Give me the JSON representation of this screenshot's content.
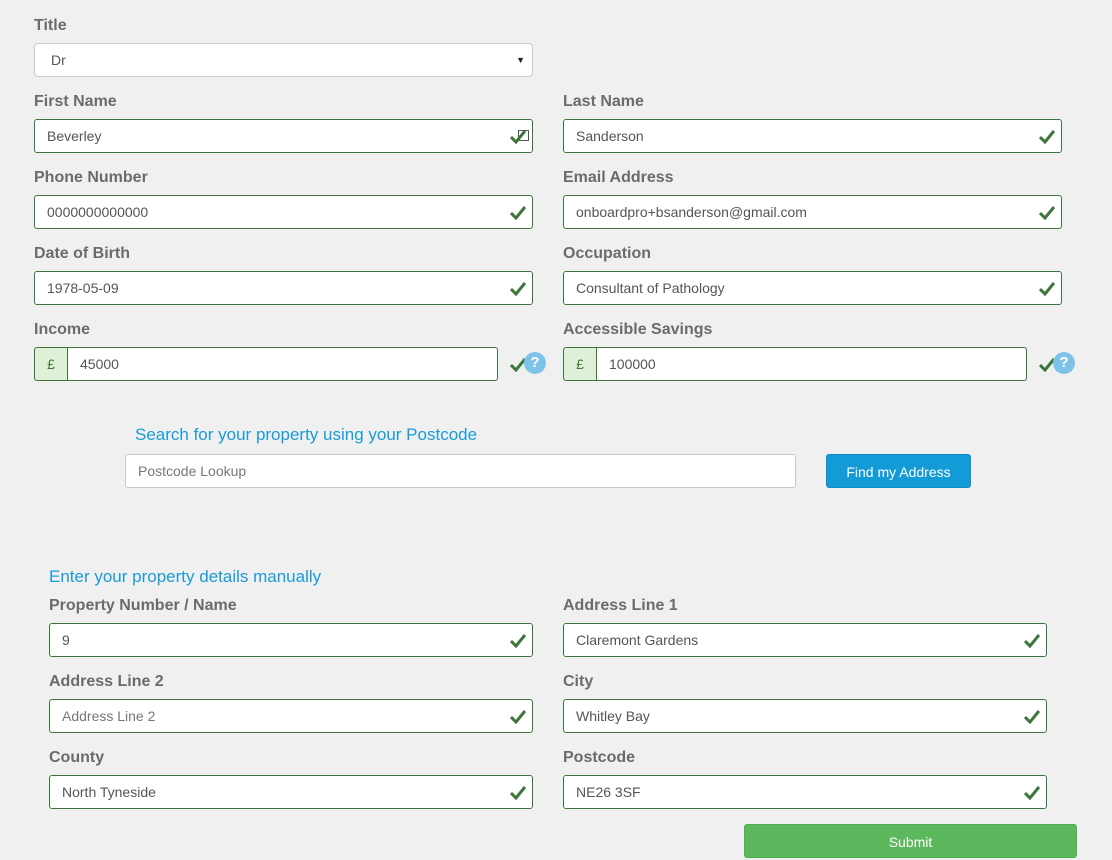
{
  "title": {
    "label": "Title",
    "value": "Dr"
  },
  "first_name": {
    "label": "First Name",
    "value": "Beverley"
  },
  "last_name": {
    "label": "Last Name",
    "value": "Sanderson"
  },
  "phone": {
    "label": "Phone Number",
    "value": "0000000000000"
  },
  "email": {
    "label": "Email Address",
    "value": "onboardpro+bsanderson@gmail.com"
  },
  "dob": {
    "label": "Date of Birth",
    "value": "1978-05-09"
  },
  "occupation": {
    "label": "Occupation",
    "value": "Consultant of Pathology"
  },
  "income": {
    "label": "Income",
    "currency": "£",
    "value": "45000"
  },
  "savings": {
    "label": "Accessible Savings",
    "currency": "£",
    "value": "100000"
  },
  "help_glyph": "?",
  "postcode_search": {
    "heading": "Search for your property using your Postcode",
    "placeholder": "Postcode Lookup",
    "button": "Find my Address"
  },
  "manual": {
    "heading": "Enter your property details manually",
    "property_number": {
      "label": "Property Number / Name",
      "value": "9"
    },
    "address_line1": {
      "label": "Address Line 1",
      "value": "Claremont Gardens"
    },
    "address_line2": {
      "label": "Address Line 2",
      "placeholder": "Address Line 2"
    },
    "city": {
      "label": "City",
      "value": "Whitley Bay"
    },
    "county": {
      "label": "County",
      "value": "North Tyneside"
    },
    "postcode": {
      "label": "Postcode",
      "value": "NE26 3SF"
    }
  },
  "submit_label": "Submit",
  "colors": {
    "valid": "#3c763d",
    "accent": "#1a9bd7",
    "submit": "#5cb85c",
    "help": "#7dc3e8"
  }
}
